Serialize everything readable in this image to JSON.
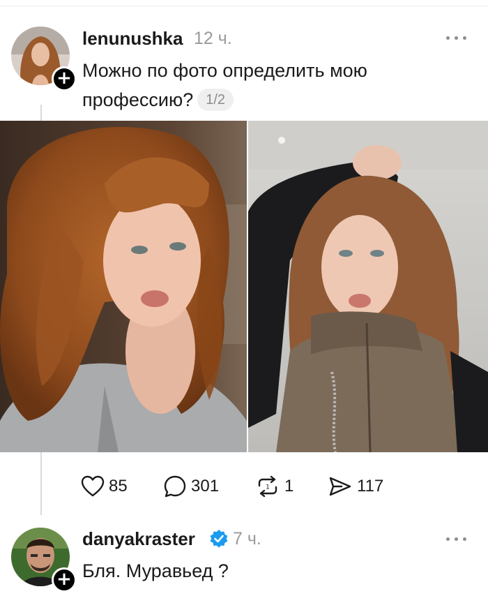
{
  "posts": [
    {
      "username": "lenunushka",
      "time": "12 ч.",
      "text": "Можно по фото определить мою профессию?",
      "image_counter": "1/2",
      "stats": {
        "likes": "85",
        "comments": "301",
        "reposts": "1",
        "shares": "117"
      }
    },
    {
      "username": "danyakraster",
      "verified": true,
      "time": "7 ч.",
      "text": "Бля. Муравьед ?"
    }
  ],
  "icons": {
    "like": "heart-icon",
    "comment": "comment-bubble-icon",
    "repost": "repost-icon",
    "share": "share-send-icon",
    "verified": "verified-badge-icon",
    "follow": "plus-icon",
    "more": "more-dots-icon"
  },
  "colors": {
    "verified": "#1d9bf0",
    "muted": "#9a9a9a",
    "badge": "#000000"
  }
}
